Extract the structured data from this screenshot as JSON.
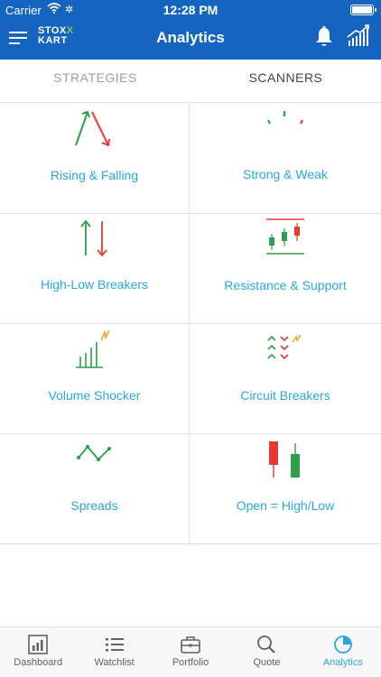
{
  "status_bar": {
    "carrier": "Carrier",
    "time": "12:28 PM"
  },
  "header": {
    "logo_top": "STOX",
    "logo_x": "X",
    "logo_bottom": "KART",
    "title": "Analytics"
  },
  "tabs": [
    {
      "label": "STRATEGIES",
      "active": false
    },
    {
      "label": "SCANNERS",
      "active": true
    }
  ],
  "scanners": [
    {
      "label": "Rising & Falling",
      "icon": "rising-falling-icon"
    },
    {
      "label": "Strong & Weak",
      "icon": "strong-weak-icon"
    },
    {
      "label": "High-Low Breakers",
      "icon": "high-low-icon"
    },
    {
      "label": "Resistance & Support",
      "icon": "resistance-support-icon"
    },
    {
      "label": "Volume Shocker",
      "icon": "volume-shocker-icon"
    },
    {
      "label": "Circuit Breakers",
      "icon": "circuit-breakers-icon"
    },
    {
      "label": "Spreads",
      "icon": "spreads-icon"
    },
    {
      "label": "Open = High/Low",
      "icon": "open-high-low-icon"
    }
  ],
  "bottom_nav": [
    {
      "label": "Dashboard",
      "icon": "dashboard-icon",
      "active": false
    },
    {
      "label": "Watchlist",
      "icon": "watchlist-icon",
      "active": false
    },
    {
      "label": "Portfolio",
      "icon": "portfolio-icon",
      "active": false
    },
    {
      "label": "Quote",
      "icon": "quote-icon",
      "active": false
    },
    {
      "label": "Analytics",
      "icon": "analytics-icon",
      "active": true
    }
  ],
  "colors": {
    "primary": "#1565c0",
    "accent": "#29a8e0",
    "green": "#2e9e4a",
    "red": "#e53935",
    "orange": "#f5a623"
  }
}
